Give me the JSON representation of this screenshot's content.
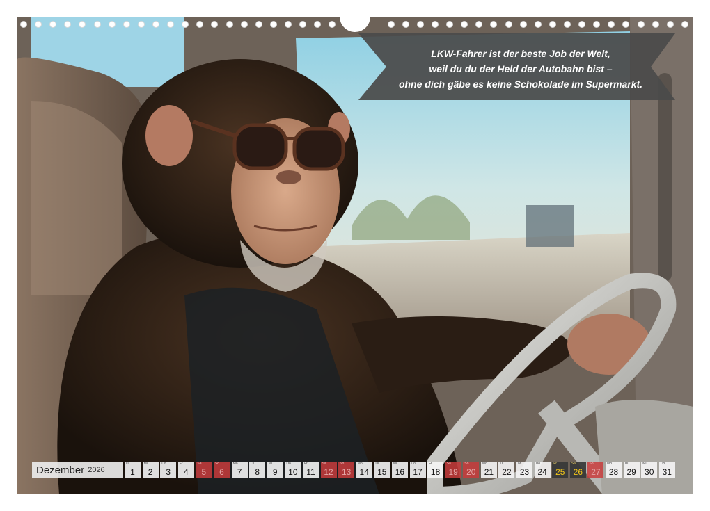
{
  "quote": {
    "lines": [
      "LKW-Fahrer ist der beste Job der Welt,",
      "weil du du der Held der Autobahn bist –",
      "ohne dich gäbe es keine Schokolade im Supermarkt."
    ]
  },
  "calendar": {
    "month": "Dezember",
    "year": "2026",
    "days": [
      {
        "wd": "Di",
        "d": "1",
        "type": "normal"
      },
      {
        "wd": "Mi",
        "d": "2",
        "type": "normal"
      },
      {
        "wd": "Do",
        "d": "3",
        "type": "normal"
      },
      {
        "wd": "Fr",
        "d": "4",
        "type": "normal"
      },
      {
        "wd": "Sa",
        "d": "5",
        "type": "sun"
      },
      {
        "wd": "So",
        "d": "6",
        "type": "sun"
      },
      {
        "wd": "Mo",
        "d": "7",
        "type": "normal"
      },
      {
        "wd": "Di",
        "d": "8",
        "type": "normal"
      },
      {
        "wd": "Mi",
        "d": "9",
        "type": "normal"
      },
      {
        "wd": "Do",
        "d": "10",
        "type": "normal"
      },
      {
        "wd": "Fr",
        "d": "11",
        "type": "normal"
      },
      {
        "wd": "Sa",
        "d": "12",
        "type": "sun"
      },
      {
        "wd": "So",
        "d": "13",
        "type": "sun"
      },
      {
        "wd": "Mo",
        "d": "14",
        "type": "normal"
      },
      {
        "wd": "Di",
        "d": "15",
        "type": "normal"
      },
      {
        "wd": "Mi",
        "d": "16",
        "type": "normal"
      },
      {
        "wd": "Do",
        "d": "17",
        "type": "normal"
      },
      {
        "wd": "Fr",
        "d": "18",
        "type": "normal"
      },
      {
        "wd": "Sa",
        "d": "19",
        "type": "sun"
      },
      {
        "wd": "So",
        "d": "20",
        "type": "sun"
      },
      {
        "wd": "Mo",
        "d": "21",
        "type": "normal"
      },
      {
        "wd": "Di",
        "d": "22",
        "type": "normal"
      },
      {
        "wd": "Mi",
        "d": "23",
        "type": "normal"
      },
      {
        "wd": "Do",
        "d": "24",
        "type": "normal"
      },
      {
        "wd": "Fr",
        "d": "25",
        "type": "holiday"
      },
      {
        "wd": "Sa",
        "d": "26",
        "type": "holiday"
      },
      {
        "wd": "So",
        "d": "27",
        "type": "sun"
      },
      {
        "wd": "Mo",
        "d": "28",
        "type": "normal"
      },
      {
        "wd": "Di",
        "d": "29",
        "type": "normal"
      },
      {
        "wd": "Mi",
        "d": "30",
        "type": "normal"
      },
      {
        "wd": "Do",
        "d": "31",
        "type": "normal"
      }
    ]
  },
  "colors": {
    "banner": "#4a4a4a",
    "sunday": "#c83c3c",
    "holiday_text": "#f0c419"
  }
}
